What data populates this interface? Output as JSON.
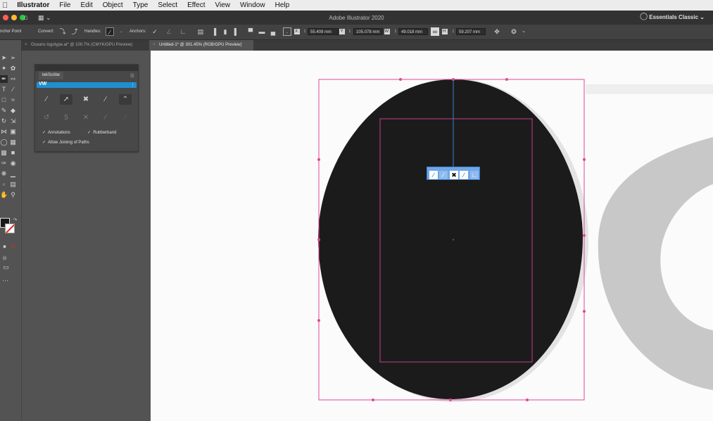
{
  "menubar": {
    "apple_icon": "apple-icon",
    "items": [
      "Illustrator",
      "File",
      "Edit",
      "Object",
      "Type",
      "Select",
      "Effect",
      "View",
      "Window",
      "Help"
    ]
  },
  "titlebar": {
    "title": "Adobe Illustrator 2020",
    "workspace": "Essentials Classic",
    "traffic_colors": [
      "#ff5f57",
      "#febc2e",
      "#28c840"
    ]
  },
  "controlbar": {
    "tool_label": "nchor Point",
    "convert_label": "Convert:",
    "handles_label": "Handles:",
    "anchors_label": "Anchors:",
    "x_label": "X:",
    "x_value": "55.409 mm",
    "y_label": "Y:",
    "y_value": "105.078 mm",
    "w_label": "W:",
    "w_value": "49.018 mm",
    "h_label": "H:",
    "h_value": "59.207 mm"
  },
  "tabs": [
    {
      "label": "Oceans logotype.ai* @ 100.7% (CMYK/GPU Preview)",
      "active": false
    },
    {
      "label": "Untitled-1* @ 301.45% (RGB/GPU Preview)",
      "active": true
    }
  ],
  "panel": {
    "title": "tekScribe",
    "logo": "VW",
    "row2_number": "5",
    "options": [
      {
        "label": "Annotations",
        "checked": true
      },
      {
        "label": "Rubberband",
        "checked": true
      },
      {
        "label": "Allow Joining of Paths",
        "checked": true
      }
    ]
  },
  "colors": {
    "accent": "#1f8fd1",
    "selection": "#e0479a",
    "shape_fill": "#1b1b1b",
    "path_line": "#3d7fd6"
  }
}
